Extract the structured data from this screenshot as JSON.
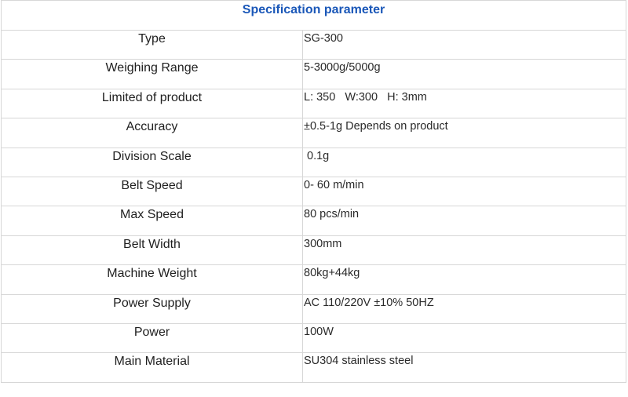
{
  "table": {
    "title": "Specification parameter",
    "rows": [
      {
        "label": "Type",
        "value": "SG-300"
      },
      {
        "label": "Weighing Range",
        "value": "5-3000g/5000g"
      },
      {
        "label": "Limited of product",
        "value": "L: 350   W:300   H: 3mm"
      },
      {
        "label": "Accuracy",
        "value": "±0.5-1g Depends on product"
      },
      {
        "label": "Division Scale",
        "value": " 0.1g"
      },
      {
        "label": "Belt Speed",
        "value": "0- 60 m/min"
      },
      {
        "label": "Max Speed",
        "value": "80 pcs/min"
      },
      {
        "label": "Belt Width",
        "value": "300mm"
      },
      {
        "label": "Machine Weight",
        "value": "80kg+44kg"
      },
      {
        "label": "Power Supply",
        "value": "AC 110/220V ±10% 50HZ"
      },
      {
        "label": "Power",
        "value": "100W"
      },
      {
        "label": "Main Material",
        "value": "SU304 stainless steel"
      }
    ]
  }
}
